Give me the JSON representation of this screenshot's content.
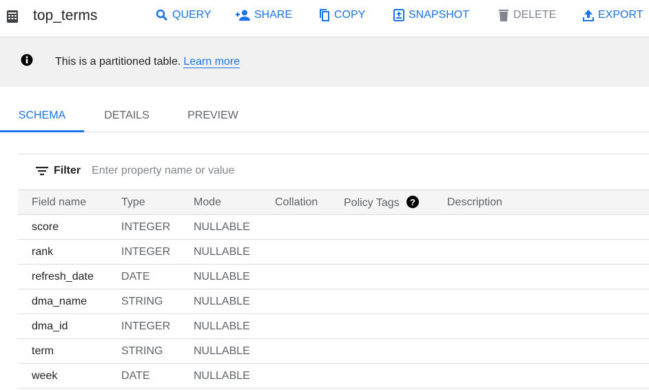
{
  "header": {
    "title": "top_terms",
    "actions": {
      "query": "QUERY",
      "share": "SHARE",
      "copy": "COPY",
      "snapshot": "SNAPSHOT",
      "delete": "DELETE",
      "export": "EXPORT"
    }
  },
  "banner": {
    "text": "This is a partitioned table.",
    "link": "Learn more"
  },
  "tabs": [
    "SCHEMA",
    "DETAILS",
    "PREVIEW"
  ],
  "filter": {
    "label": "Filter",
    "placeholder": "Enter property name or value"
  },
  "table": {
    "columns": [
      "Field name",
      "Type",
      "Mode",
      "Collation",
      "Policy Tags",
      "Description"
    ],
    "rows": [
      [
        "score",
        "INTEGER",
        "NULLABLE"
      ],
      [
        "rank",
        "INTEGER",
        "NULLABLE"
      ],
      [
        "refresh_date",
        "DATE",
        "NULLABLE"
      ],
      [
        "dma_name",
        "STRING",
        "NULLABLE"
      ],
      [
        "dma_id",
        "INTEGER",
        "NULLABLE"
      ],
      [
        "term",
        "STRING",
        "NULLABLE"
      ],
      [
        "week",
        "DATE",
        "NULLABLE"
      ]
    ]
  }
}
